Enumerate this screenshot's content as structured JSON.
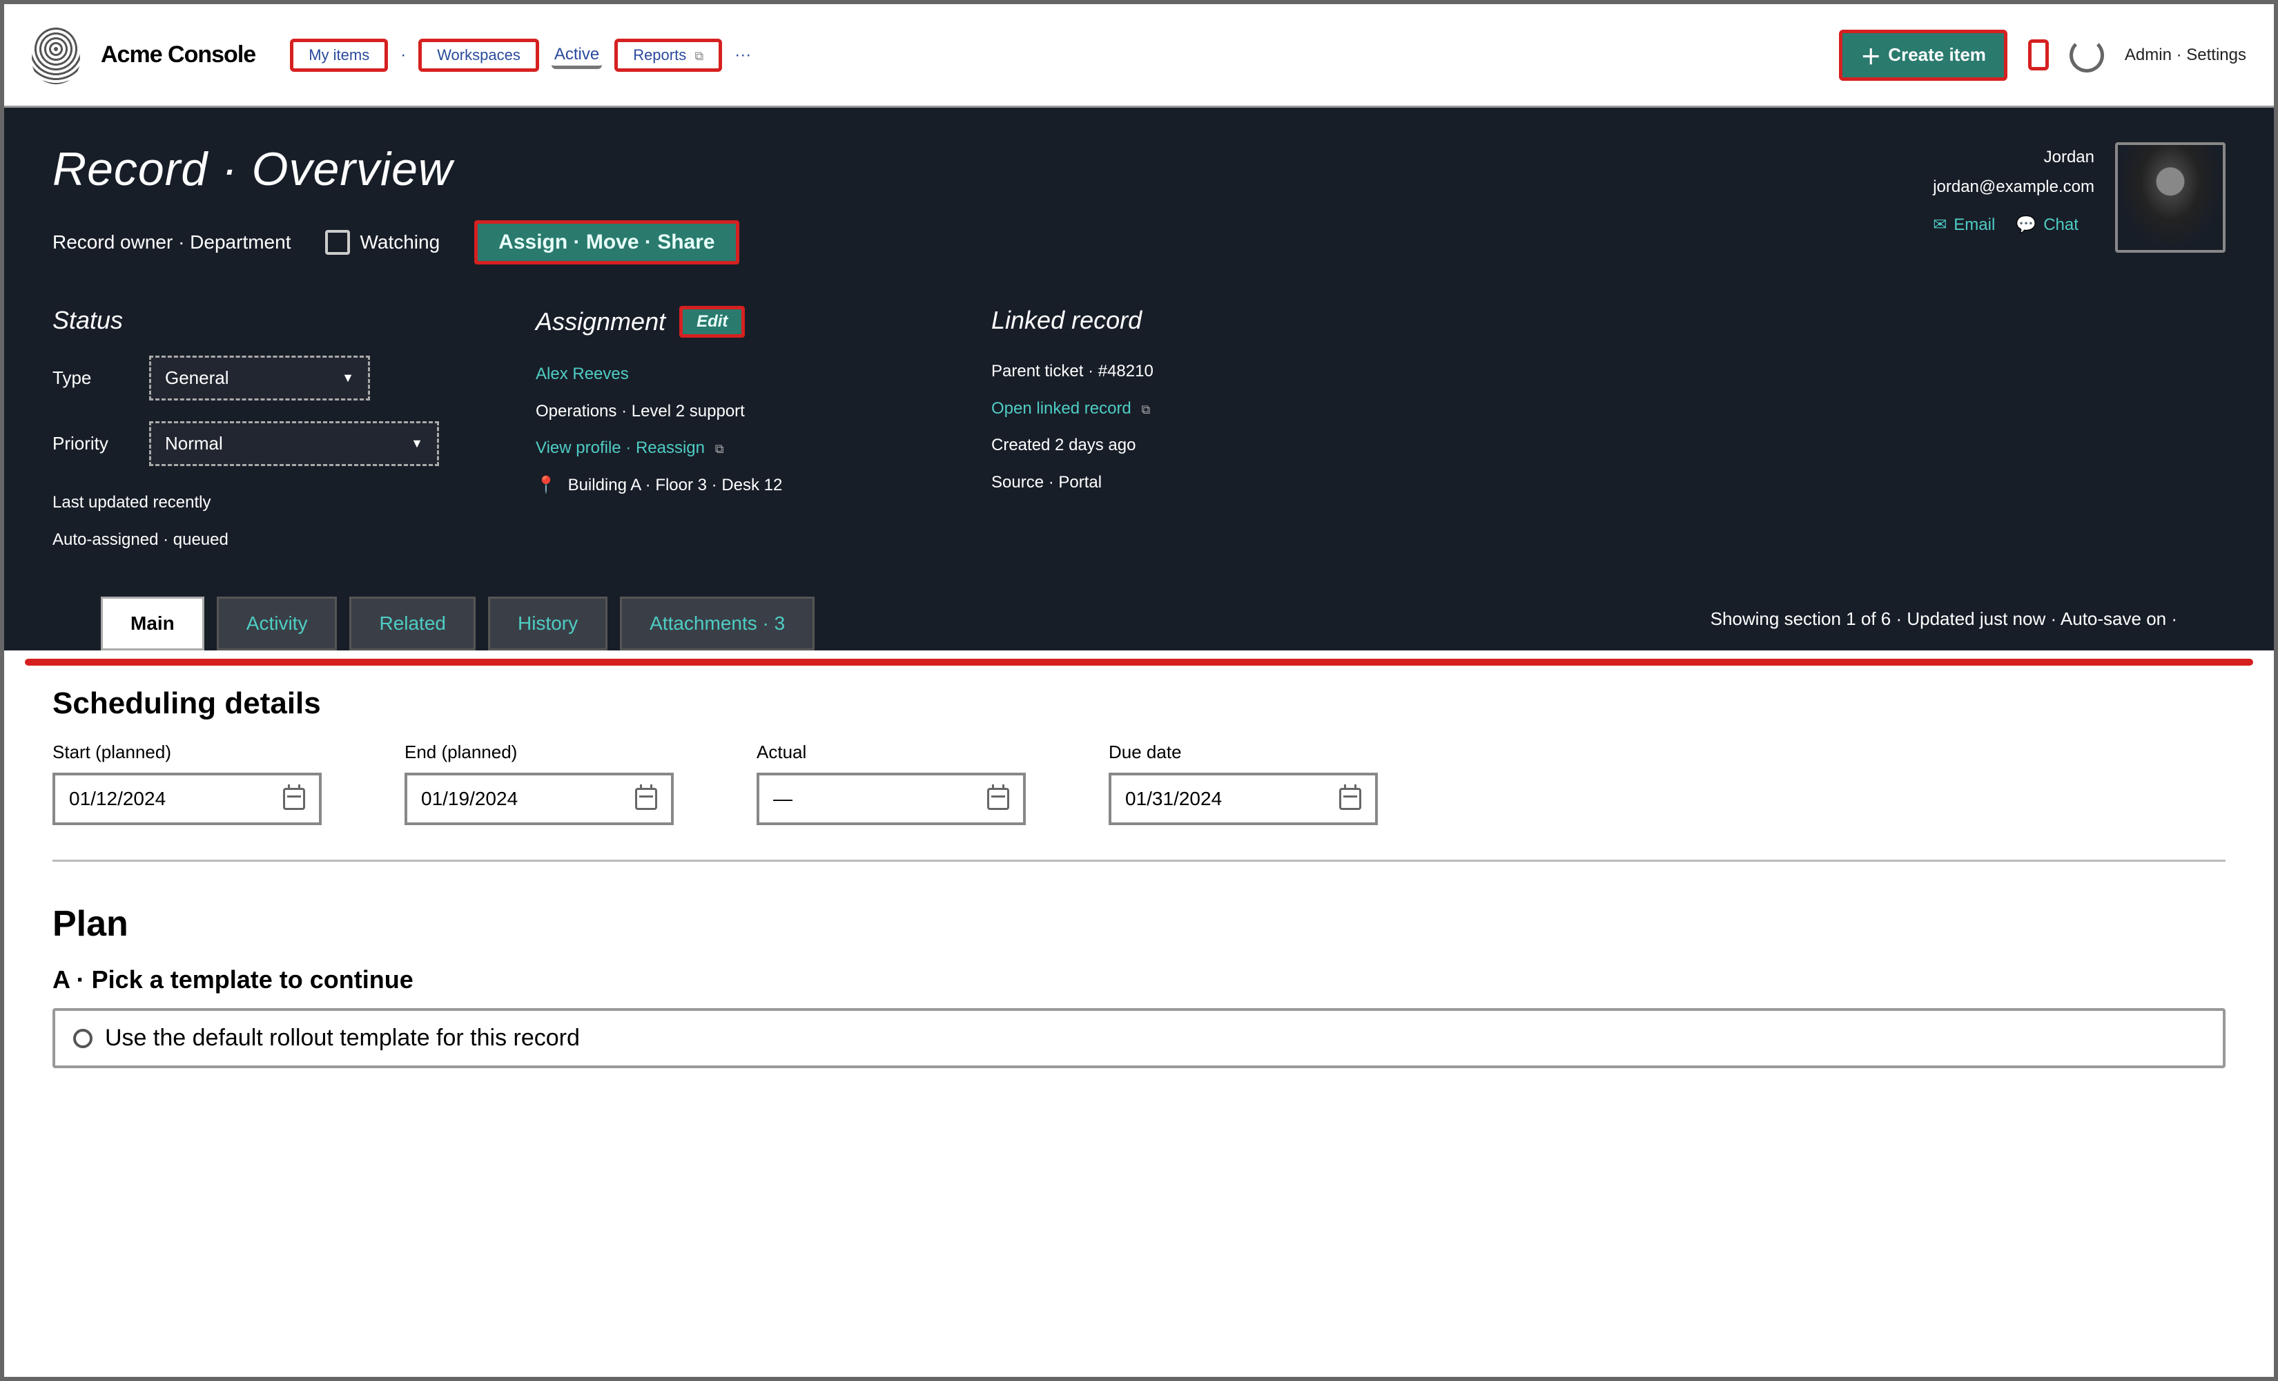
{
  "topbar": {
    "brand": "Acme Console",
    "tabs": [
      {
        "label": "My items"
      },
      {
        "label": "Workspaces"
      },
      {
        "label": "Active",
        "underlined": true
      },
      {
        "label": "Reports",
        "external": true
      }
    ],
    "primary_button": "Create item",
    "right_text": "Admin · Settings"
  },
  "hero": {
    "title": "Record · Overview",
    "subtitle": "Record owner · Department",
    "checkbox_label": "Watching",
    "ribbon_label": "Assign · Move · Share",
    "contact": {
      "name": "Jordan",
      "line2": "jordan@example.com",
      "email_label": "Email",
      "chat_label": "Chat"
    },
    "col1": {
      "heading": "Status",
      "field1_label": "Type",
      "field1_value": "General",
      "field2_label": "Priority",
      "field2_value": "Normal",
      "meta1": "Last updated recently",
      "meta2": "Auto-assigned · queued"
    },
    "col2": {
      "heading": "Assignment",
      "pill": "Edit",
      "line1": "Alex Reeves",
      "line2": "Operations · Level 2 support",
      "line3": "View profile · Reassign",
      "line4": "Building A · Floor 3 · Desk 12"
    },
    "col3": {
      "heading": "Linked record",
      "line1": "Parent ticket · #48210",
      "line2": "Open linked record",
      "line3": "Created 2 days ago",
      "line4": "Source · Portal"
    }
  },
  "subtabs": {
    "items": [
      {
        "label": "Main",
        "active": true
      },
      {
        "label": "Activity"
      },
      {
        "label": "Related"
      },
      {
        "label": "History"
      },
      {
        "label": "Attachments · 3"
      }
    ],
    "right_text": "Showing section 1 of 6 · Updated just now · Auto-save on ·"
  },
  "content": {
    "dates_heading": "Scheduling details",
    "dates": [
      {
        "label": "Start (planned)",
        "value": "01/12/2024"
      },
      {
        "label": "End (planned)",
        "value": "01/19/2024"
      },
      {
        "label": "Actual",
        "value": "—"
      },
      {
        "label": "Due date",
        "value": "01/31/2024"
      }
    ],
    "section2": {
      "heading": "Plan",
      "sublabel": "A · Pick a template to continue",
      "box_text": "Use the default rollout template for this record"
    }
  }
}
